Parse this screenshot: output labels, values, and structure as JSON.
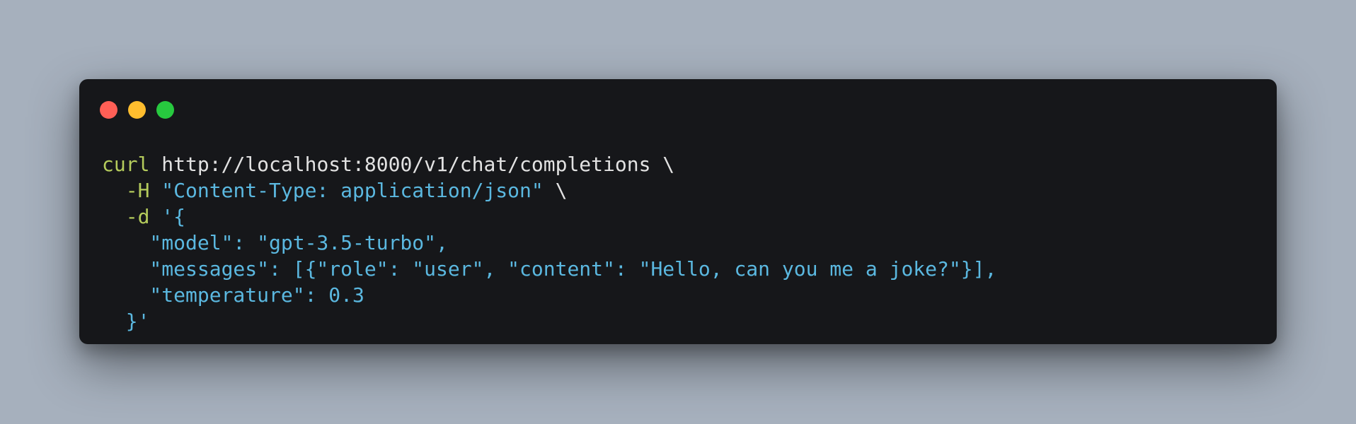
{
  "colors": {
    "background": "#a6b0bd",
    "window": "#16171a",
    "close": "#ff5f56",
    "minimize": "#ffbd2e",
    "zoom": "#27c93f",
    "command": "#b5cc5c",
    "string": "#5bb8e0",
    "plain": "#e2e2e2"
  },
  "window_controls": [
    "close",
    "minimize",
    "zoom"
  ],
  "code": {
    "line1": {
      "cmd": "curl",
      "url": " http://localhost:8000/v1/chat/completions",
      "cont": " \\"
    },
    "line2": {
      "indent": "  ",
      "flag": "-H",
      "str": " \"Content-Type: application/json\"",
      "cont": " \\"
    },
    "line3": {
      "indent": "  ",
      "flag": "-d",
      "str": " '{"
    },
    "line4": {
      "text": "    \"model\": \"gpt-3.5-turbo\","
    },
    "line5": {
      "text": "    \"messages\": [{\"role\": \"user\", \"content\": \"Hello, can you me a joke?\"}],"
    },
    "line6": {
      "text": "    \"temperature\": 0.3"
    },
    "line7": {
      "text": "  }'"
    }
  }
}
